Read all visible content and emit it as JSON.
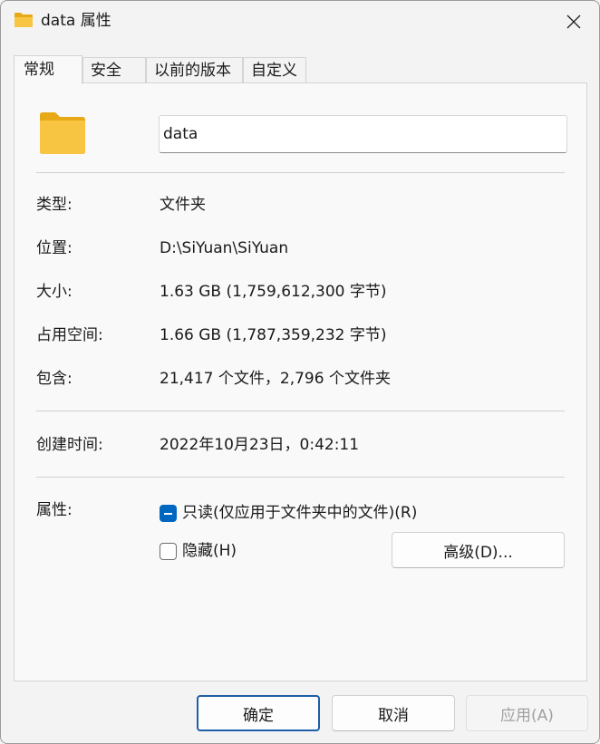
{
  "window": {
    "title": "data 属性",
    "close_icon": "close-icon"
  },
  "tabs": [
    {
      "label": "常规",
      "active": true
    },
    {
      "label": "安全",
      "active": false
    },
    {
      "label": "以前的版本",
      "active": false
    },
    {
      "label": "自定义",
      "active": false
    }
  ],
  "general": {
    "folder_icon": "folder-icon",
    "name_value": "data",
    "rows": [
      {
        "label": "类型:",
        "value": "文件夹"
      },
      {
        "label": "位置:",
        "value": "D:\\SiYuan\\SiYuan"
      },
      {
        "label": "大小:",
        "value": "1.63 GB (1,759,612,300 字节)"
      },
      {
        "label": "占用空间:",
        "value": "1.66 GB (1,787,359,232 字节)"
      },
      {
        "label": "包含:",
        "value": "21,417 个文件，2,796 个文件夹"
      }
    ],
    "created": {
      "label": "创建时间:",
      "value": "2022年10月23日，0:42:11"
    },
    "attributes": {
      "label": "属性:",
      "readonly": {
        "label": "只读(仅应用于文件夹中的文件)(R)",
        "state": "indeterminate"
      },
      "hidden": {
        "label": "隐藏(H)",
        "state": "unchecked"
      },
      "advanced_label": "高级(D)..."
    }
  },
  "footer": {
    "ok": "确定",
    "cancel": "取消",
    "apply": "应用(A)"
  },
  "colors": {
    "accent": "#0067c0",
    "folder": "#f8c543",
    "background": "#f3f3f3"
  }
}
